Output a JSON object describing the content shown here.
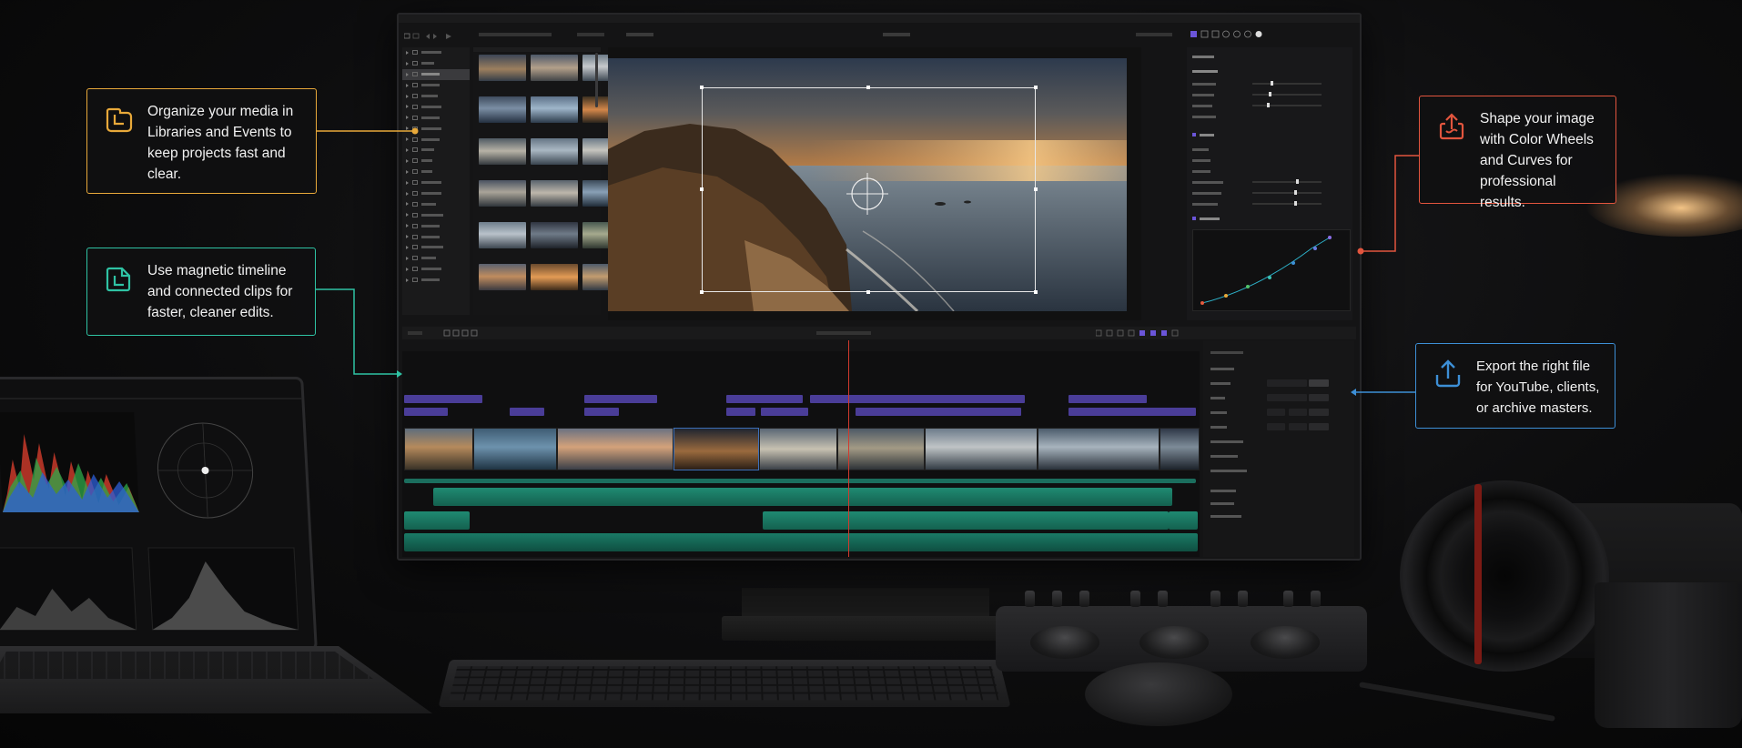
{
  "callouts": {
    "organize": {
      "text": "Organize your media in Libraries and Events to keep projects fast and clear.",
      "icon": "library-icon",
      "color": "#e8a93a"
    },
    "magnetic": {
      "text": "Use magnetic timeline and connected clips for faster, cleaner edits.",
      "icon": "timeline-clip-icon",
      "color": "#2fc3a4"
    },
    "shape": {
      "text": "Shape your image with Color Wheels and Curves for professional results.",
      "icon": "color-share-icon",
      "color": "#e2553e"
    },
    "export": {
      "text": "Export the right file for YouTube, clients, or archive masters.",
      "icon": "export-upload-icon",
      "color": "#3d8fd6"
    }
  },
  "colors": {
    "playhead": "#d23a2d",
    "connected_clip": "#4a3d98",
    "audio_clip": "#1f8a72",
    "panel_bg": "#141415"
  }
}
